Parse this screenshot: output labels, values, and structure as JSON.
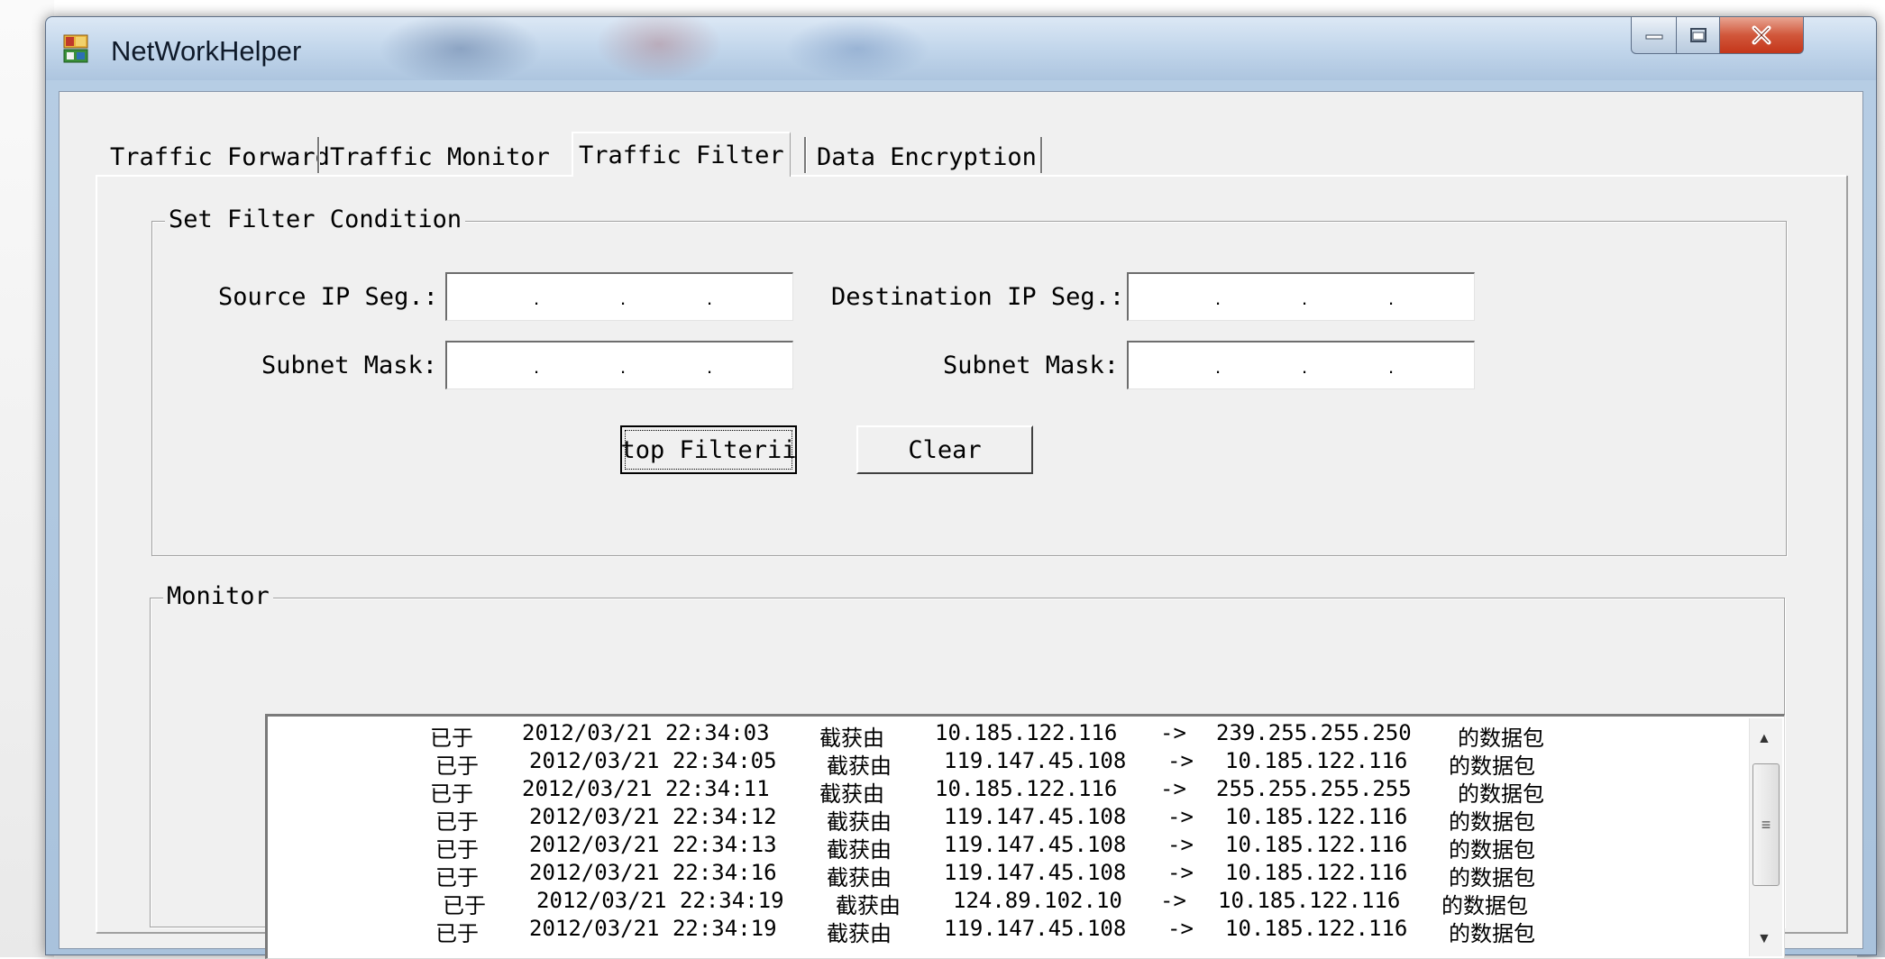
{
  "window": {
    "title": "NetWorkHelper",
    "icons": {
      "app": "network-app-icon",
      "minimize": "minimize-icon",
      "maximize": "maximize-icon",
      "close": "close-icon"
    }
  },
  "tabs": [
    {
      "label": "Traffic Forward",
      "selected": false
    },
    {
      "label": "Traffic Monitor",
      "selected": false
    },
    {
      "label": "Traffic Filter",
      "selected": true
    },
    {
      "label": "Data Encryption",
      "selected": false
    }
  ],
  "filter_group": {
    "legend": "Set Filter Condition",
    "source_ip_label": "Source IP Seg.:",
    "source_mask_label": "Subnet Mask:",
    "dest_ip_label": "Destination IP Seg.:",
    "dest_mask_label": "Subnet Mask:",
    "ip_dots": [
      ".",
      ".",
      "."
    ],
    "stop_button": "top Filterii",
    "clear_button": "Clear"
  },
  "monitor_group": {
    "legend": "Monitor",
    "rows": [
      {
        "prefix": "已于",
        "time": "2012/03/21 22:34:03",
        "verb": "截获由",
        "src": "10.185.122.116",
        "arrow": "->",
        "dst": "239.255.255.250",
        "suffix": "的数据包"
      },
      {
        "prefix": "已于",
        "time": "2012/03/21 22:34:05",
        "verb": "截获由",
        "src": "119.147.45.108",
        "arrow": "->",
        "dst": "10.185.122.116",
        "suffix": "的数据包"
      },
      {
        "prefix": "已于",
        "time": "2012/03/21 22:34:11",
        "verb": "截获由",
        "src": "10.185.122.116",
        "arrow": "->",
        "dst": "255.255.255.255",
        "suffix": "的数据包"
      },
      {
        "prefix": "已于",
        "time": "2012/03/21 22:34:12",
        "verb": "截获由",
        "src": "119.147.45.108",
        "arrow": "->",
        "dst": "10.185.122.116",
        "suffix": "的数据包"
      },
      {
        "prefix": "已于",
        "time": "2012/03/21 22:34:13",
        "verb": "截获由",
        "src": "119.147.45.108",
        "arrow": "->",
        "dst": "10.185.122.116",
        "suffix": "的数据包"
      },
      {
        "prefix": "已于",
        "time": "2012/03/21 22:34:16",
        "verb": "截获由",
        "src": "119.147.45.108",
        "arrow": "->",
        "dst": "10.185.122.116",
        "suffix": "的数据包"
      },
      {
        "prefix": "已于",
        "time": "2012/03/21 22:34:19",
        "verb": "截获由",
        "src": "124.89.102.10",
        "arrow": "->",
        "dst": "10.185.122.116",
        "suffix": "的数据包"
      },
      {
        "prefix": "已于",
        "time": "2012/03/21 22:34:19",
        "verb": "截获由",
        "src": "119.147.45.108",
        "arrow": "->",
        "dst": "10.185.122.116",
        "suffix": "的数据包"
      }
    ],
    "scrollbar": {
      "up": "▲",
      "thumb": "≡",
      "down": "▼"
    }
  }
}
